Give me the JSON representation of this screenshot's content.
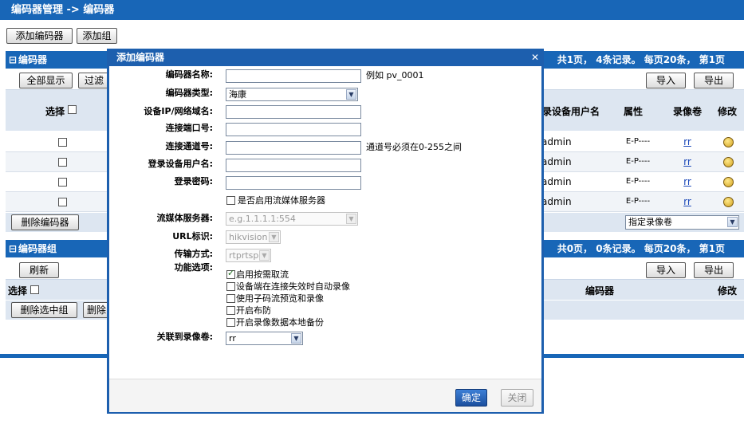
{
  "page": {
    "breadcrumb": "编码器管理 -> 编码器",
    "actions": {
      "add_encoder": "添加编码器",
      "add_group": "添加组"
    }
  },
  "encoder_section": {
    "title": "编码器",
    "paging": "共1页， 4条记录。 每页20条， 第1页",
    "buttons": {
      "show_all": "全部显示",
      "filter": "过滤",
      "import": "导入",
      "export": "导出",
      "delete": "删除编码器"
    },
    "columns": {
      "select": "选择",
      "login_user": "录设备用户名",
      "attribute": "属性",
      "volume": "录像卷",
      "edit": "修改"
    },
    "rows": [
      {
        "user": "admin",
        "attr": "E-P----",
        "volume": "rr"
      },
      {
        "user": "admin",
        "attr": "E-P----",
        "volume": "rr"
      },
      {
        "user": "admin",
        "attr": "E-P----",
        "volume": "rr"
      },
      {
        "user": "admin",
        "attr": "E-P----",
        "volume": "rr"
      }
    ],
    "volume_select": "指定录像卷"
  },
  "group_section": {
    "title": "编码器组",
    "paging": "共0页， 0条记录。 每页20条， 第1页",
    "buttons": {
      "refresh": "刷新",
      "import": "导入",
      "export": "导出",
      "delete_selected": "删除选中组",
      "delete_other": "删除"
    },
    "columns": {
      "select": "选择",
      "encoder": "编码器",
      "edit": "修改"
    }
  },
  "dialog": {
    "title": "添加编码器",
    "close_glyph": "✕",
    "fields": {
      "name_label": "编码器名称:",
      "name_value": "",
      "name_hint": "例如 pv_0001",
      "type_label": "编码器类型:",
      "type_value": "海康",
      "ip_label": "设备IP/网络域名:",
      "ip_value": "",
      "port_label": "连接端口号:",
      "port_value": "",
      "channel_label": "连接通道号:",
      "channel_value": "",
      "channel_hint": "通道号必须在0-255之间",
      "user_label": "登录设备用户名:",
      "user_value": "",
      "password_label": "登录密码:",
      "password_value": "",
      "stream_server_toggle": "是否启用流媒体服务器",
      "stream_server_label": "流媒体服务器:",
      "stream_server_placeholder": "e.g.1.1.1.1:554",
      "url_label": "URL标识:",
      "url_value": "hikvision",
      "transport_label": "传输方式:",
      "transport_value": "rtprtsp",
      "features_label": "功能选项:",
      "volume_label": "关联到录像卷:",
      "volume_value": "rr"
    },
    "features": [
      {
        "label": "启用按需取流",
        "checked": true
      },
      {
        "label": "设备端在连接失效时自动录像",
        "checked": false
      },
      {
        "label": "使用子码流预览和录像",
        "checked": false
      },
      {
        "label": "开启布防",
        "checked": false
      },
      {
        "label": "开启录像数据本地备份",
        "checked": false
      }
    ],
    "buttons": {
      "ok": "确定",
      "close": "关闭"
    }
  }
}
